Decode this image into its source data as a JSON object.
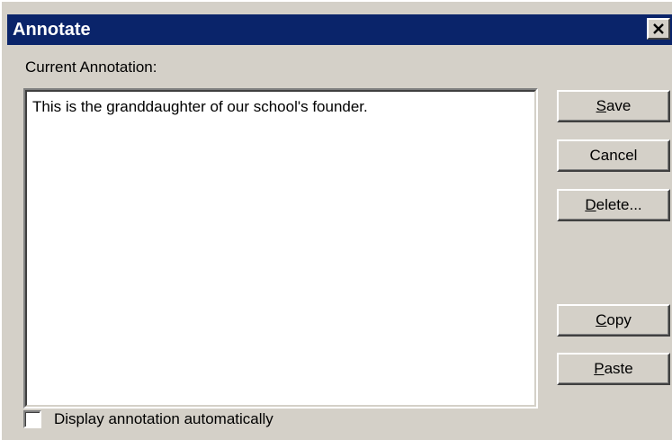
{
  "window": {
    "title": "Annotate",
    "close_symbol": "×"
  },
  "annotation": {
    "label": "Current Annotation:",
    "value": "This is the granddaughter of our school's founder."
  },
  "buttons": {
    "save": {
      "mnemonic": "S",
      "rest": "ave"
    },
    "cancel": {
      "label": "Cancel"
    },
    "delete": {
      "mnemonic": "D",
      "rest": "elete..."
    },
    "copy": {
      "mnemonic": "C",
      "rest": "opy"
    },
    "paste": {
      "mnemonic": "P",
      "rest": "aste"
    }
  },
  "options": {
    "display_auto_label": "Display annotation automatically",
    "display_auto_checked": false
  },
  "colors": {
    "titlebar": "#0a246a",
    "face": "#d4d0c8",
    "title_text": "#ffffff"
  },
  "icons": {
    "close": "close-icon"
  }
}
